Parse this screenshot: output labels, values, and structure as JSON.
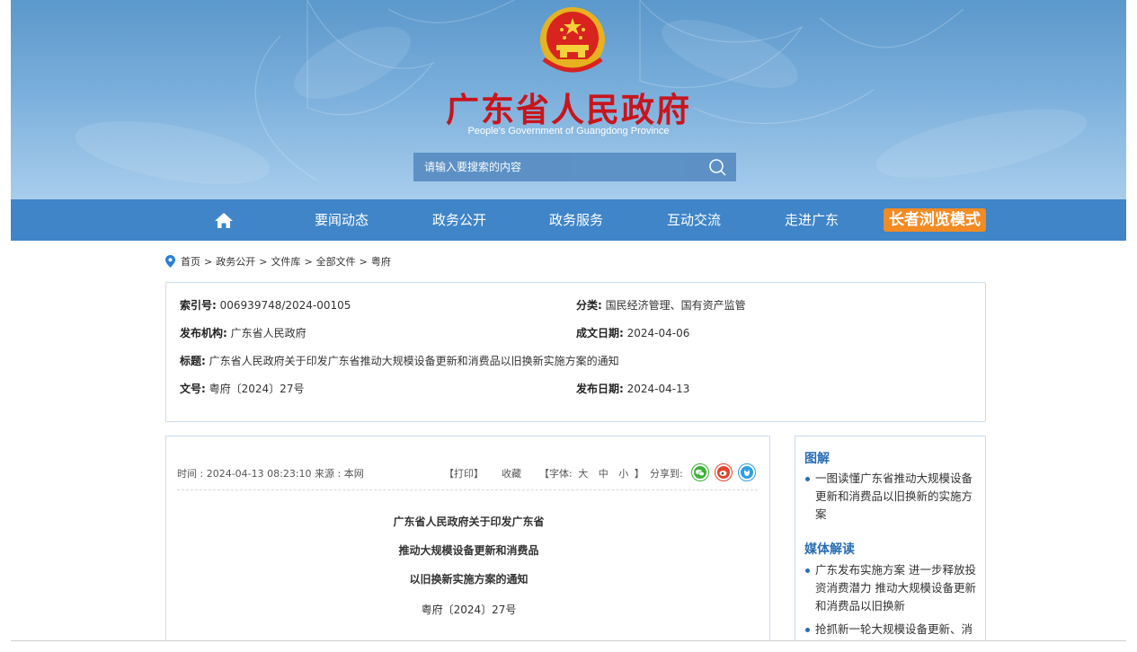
{
  "header": {
    "site_title": "广东省人民政府",
    "site_subtitle": "People's Government of Guangdong Province",
    "search_placeholder": "请输入要搜索的内容",
    "colors": {
      "hero_blue": "#5b98cb",
      "nav_blue": "#3f85c8",
      "title_red": "#c8151d",
      "elder_orange": "#f28b24"
    }
  },
  "nav": {
    "home_icon": "home-icon",
    "items": [
      "要闻动态",
      "政务公开",
      "政务服务",
      "互动交流",
      "走进广东"
    ],
    "elder_mode": "长者浏览模式"
  },
  "breadcrumb": {
    "icon": "location-pin-icon",
    "items": [
      "首页",
      "政务公开",
      "文件库",
      "全部文件",
      "粤府"
    ],
    "separator": ">"
  },
  "meta": {
    "index_label": "索引号:",
    "index_value": "006939748/2024-00105",
    "category_label": "分类:",
    "category_value": "国民经济管理、国有资产监管",
    "issuer_label": "发布机构:",
    "issuer_value": "广东省人民政府",
    "date_made_label": "成文日期:",
    "date_made_value": "2024-04-06",
    "title_label": "标题:",
    "title_value": "广东省人民政府关于印发广东省推动大规模设备更新和消费品以旧换新实施方案的通知",
    "docno_label": "文号:",
    "docno_value": "粤府〔2024〕27号",
    "publish_label": "发布日期:",
    "publish_value": "2024-04-13"
  },
  "article": {
    "time": "时间 : 2024-04-13 08:23:10",
    "source": "来源 : 本网",
    "print": "【打印】",
    "favorite": "收藏",
    "font_prefix": "【字体:",
    "font_large": "大",
    "font_medium": "中",
    "font_small": "小",
    "font_suffix": "】",
    "share_label": "分享到:",
    "share_icons": [
      "wechat-icon",
      "weibo-icon",
      "qq-icon"
    ],
    "title_lines": [
      "广东省人民政府关于印发广东省",
      "推动大规模设备更新和消费品",
      "以旧换新实施方案的通知"
    ],
    "doc_number": "粤府〔2024〕27号"
  },
  "sidebar": {
    "sections": [
      {
        "heading": "图解",
        "items": [
          "一图读懂广东省推动大规模设备更新和消费品以旧换新的实施方案"
        ]
      },
      {
        "heading": "媒体解读",
        "items": [
          "广东发布实施方案 进一步释放投资消费潜力 推动大规模设备更新和消费品以旧换新",
          "抢抓新一轮大规模设备更新、消"
        ]
      }
    ]
  }
}
